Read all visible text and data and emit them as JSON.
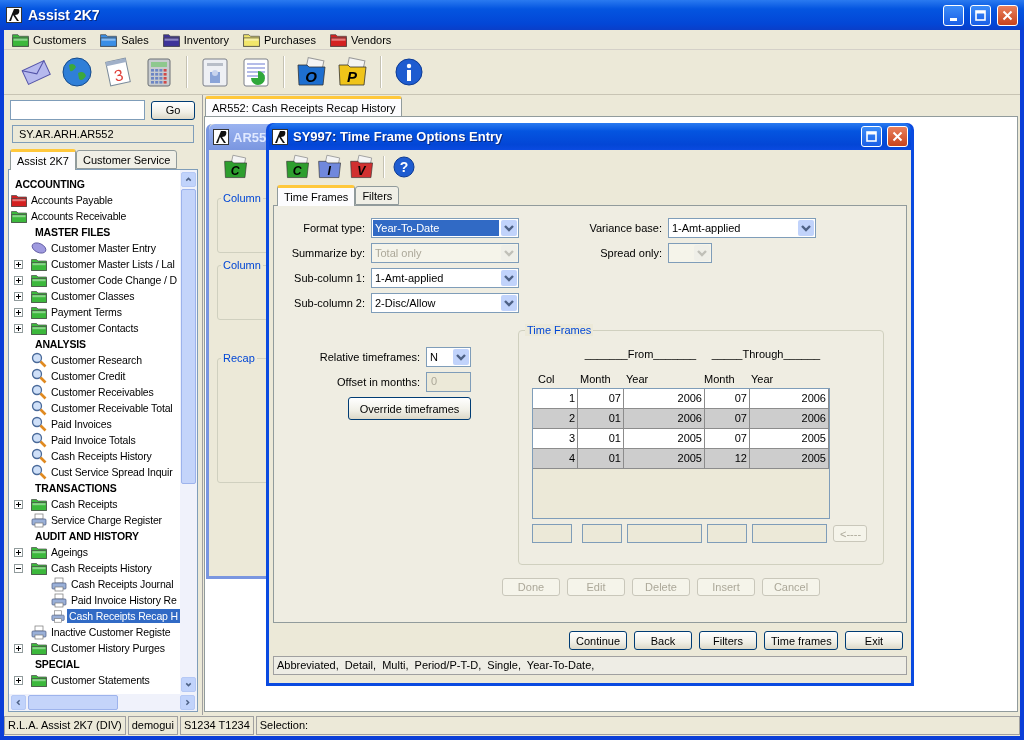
{
  "window": {
    "title": "Assist 2K7"
  },
  "menus": [
    {
      "label": "Customers",
      "color": "#3cb83c"
    },
    {
      "label": "Sales",
      "color": "#3a8ee6"
    },
    {
      "label": "Inventory",
      "color": "#3d3399"
    },
    {
      "label": "Purchases",
      "color": "#f2e66a"
    },
    {
      "label": "Vendors",
      "color": "#d42020"
    }
  ],
  "toolbar": [
    {
      "kind": "envelope"
    },
    {
      "kind": "globe"
    },
    {
      "kind": "calendar",
      "letter": "3"
    },
    {
      "kind": "calculator"
    },
    {
      "kind": "separator"
    },
    {
      "kind": "contacts"
    },
    {
      "kind": "report"
    },
    {
      "kind": "separator"
    },
    {
      "kind": "folder",
      "letter": "O",
      "color": "#1e6fd0"
    },
    {
      "kind": "folder",
      "letter": "P",
      "color": "#f0c419"
    },
    {
      "kind": "separator"
    },
    {
      "kind": "info"
    }
  ],
  "sidebar": {
    "go_button": "Go",
    "path": "SY.AR.ARH.AR552",
    "tabs": [
      {
        "label": "Assist 2K7",
        "selected": true
      },
      {
        "label": "Customer Service",
        "selected": false
      }
    ],
    "tree": [
      {
        "kind": "heading",
        "label": "ACCOUNTING",
        "selected": false
      },
      {
        "kind": "folder",
        "label": "Accounts Payable",
        "color": "#d42020",
        "selected": false
      },
      {
        "kind": "folder",
        "label": "Accounts Receivable",
        "color": "#3cb83c",
        "selected": false,
        "children": [
          {
            "kind": "heading",
            "label": "MASTER FILES",
            "selected": false
          },
          {
            "kind": "entry",
            "label": "Customer Master Entry",
            "selected": false
          },
          {
            "kind": "folder",
            "label": "Customer Master Lists / Lal",
            "color": "#3cb83c",
            "expanded": false,
            "selected": false
          },
          {
            "kind": "folder",
            "label": "Customer Code Change / D",
            "color": "#3cb83c",
            "expanded": false,
            "selected": false
          },
          {
            "kind": "folder",
            "label": "Customer Classes",
            "color": "#3cb83c",
            "expanded": false,
            "selected": false
          },
          {
            "kind": "folder",
            "label": "Payment Terms",
            "color": "#3cb83c",
            "expanded": false,
            "selected": false
          },
          {
            "kind": "folder",
            "label": "Customer Contacts",
            "color": "#3cb83c",
            "expanded": false,
            "selected": false
          },
          {
            "kind": "heading",
            "label": "ANALYSIS",
            "selected": false
          },
          {
            "kind": "search",
            "label": "Customer Research",
            "selected": false
          },
          {
            "kind": "search",
            "label": "Customer Credit",
            "selected": false
          },
          {
            "kind": "search",
            "label": "Customer Receivables",
            "selected": false
          },
          {
            "kind": "search",
            "label": "Customer Receivable Total",
            "selected": false
          },
          {
            "kind": "search",
            "label": "Paid Invoices",
            "selected": false
          },
          {
            "kind": "search",
            "label": "Paid Invoice Totals",
            "selected": false
          },
          {
            "kind": "search",
            "label": "Cash Receipts History",
            "selected": false
          },
          {
            "kind": "search",
            "label": "Cust Service Spread Inquir",
            "selected": false
          },
          {
            "kind": "heading",
            "label": "TRANSACTIONS",
            "selected": false
          },
          {
            "kind": "folder",
            "label": "Cash Receipts",
            "color": "#3cb83c",
            "expanded": false,
            "selected": false
          },
          {
            "kind": "printer",
            "label": "Service Charge Register",
            "selected": false
          },
          {
            "kind": "heading",
            "label": "AUDIT AND HISTORY",
            "selected": false
          },
          {
            "kind": "folder",
            "label": "Ageings",
            "color": "#3cb83c",
            "expanded": false,
            "selected": false
          },
          {
            "kind": "folder",
            "label": "Cash Receipts History",
            "color": "#3cb83c",
            "expanded": true,
            "selected": false,
            "children": [
              {
                "kind": "printer",
                "label": "Cash Receipts Journal",
                "selected": false
              },
              {
                "kind": "printer",
                "label": "Paid Invoice History Re",
                "selected": false
              },
              {
                "kind": "printer",
                "label": "Cash Receipts Recap H",
                "selected": true
              }
            ]
          },
          {
            "kind": "printer",
            "label": "Inactive Customer Registe",
            "selected": false
          },
          {
            "kind": "folder",
            "label": "Customer History Purges",
            "color": "#3cb83c",
            "expanded": false,
            "selected": false
          },
          {
            "kind": "heading",
            "label": "SPECIAL",
            "selected": false
          },
          {
            "kind": "folder",
            "label": "Customer Statements",
            "color": "#3cb83c",
            "expanded": false,
            "selected": false
          }
        ]
      }
    ]
  },
  "workspace_tab": {
    "label": "AR552: Cash Receipts Recap History",
    "selected": true
  },
  "background_window": {
    "title": "AR55",
    "toolbar": [
      {
        "kind": "folder",
        "letter": "C",
        "color": "#2e9e2e"
      }
    ],
    "groups": [
      "Column",
      "Column",
      "Recap"
    ]
  },
  "dialog": {
    "title": "SY997: Time Frame Options Entry",
    "toolbar": [
      {
        "kind": "folder",
        "letter": "C",
        "color": "#2e9e2e"
      },
      {
        "kind": "folder",
        "letter": "I",
        "color": "#7088dc"
      },
      {
        "kind": "folder",
        "letter": "V",
        "color": "#d03030"
      },
      {
        "kind": "separator"
      },
      {
        "kind": "help",
        "letter": "?"
      }
    ],
    "tabs": [
      {
        "label": "Time Frames",
        "selected": true
      },
      {
        "label": "Filters",
        "selected": false
      }
    ],
    "fields_left": [
      {
        "label": "Format type:",
        "value": "Year-To-Date",
        "focused": true,
        "disabled": false
      },
      {
        "label": "Summarize by:",
        "value": "Total only",
        "focused": false,
        "disabled": true
      },
      {
        "label": "Sub-column 1:",
        "value": "1-Amt-applied",
        "focused": false,
        "disabled": false
      },
      {
        "label": "Sub-column 2:",
        "value": "2-Disc/Allow",
        "focused": false,
        "disabled": false
      }
    ],
    "fields_right": [
      {
        "label": "Variance base:",
        "value": "1-Amt-applied",
        "focused": false,
        "disabled": false
      },
      {
        "label": "Spread only:",
        "disabled": true
      }
    ],
    "relative": {
      "label": "Relative timeframes:",
      "value": "N"
    },
    "offset": {
      "label": "Offset in months:",
      "value": "0",
      "disabled": true
    },
    "override_button": "Override timeframes",
    "time_frames": {
      "title": "Time Frames",
      "groups": [
        "_______From_______",
        "_____Through______"
      ],
      "columns": [
        "Col",
        "Month",
        "Year",
        "Month",
        "Year"
      ],
      "rows": [
        [
          "1",
          "07",
          "2006",
          "07",
          "2006"
        ],
        [
          "2",
          "01",
          "2006",
          "07",
          "2006"
        ],
        [
          "3",
          "01",
          "2005",
          "07",
          "2005"
        ],
        [
          "4",
          "01",
          "2005",
          "12",
          "2005"
        ]
      ],
      "edit_button": {
        "label": "<----",
        "disabled": true
      }
    },
    "actions": [
      {
        "label": "Done",
        "disabled": true
      },
      {
        "label": "Edit",
        "disabled": true
      },
      {
        "label": "Delete",
        "disabled": true
      },
      {
        "label": "Insert",
        "disabled": true
      },
      {
        "label": "Cancel",
        "disabled": true
      }
    ],
    "buttons": [
      "Continue",
      "Back",
      "Filters",
      "Time frames",
      "Exit"
    ],
    "status": "Abbreviated,  Detail,  Multi,  Period/P-T-D,  Single,  Year-To-Date,"
  },
  "status_bar": [
    "R.L.A. Assist 2K7 (DIV)",
    "demogui",
    "S1234 T1234",
    "Selection:"
  ]
}
